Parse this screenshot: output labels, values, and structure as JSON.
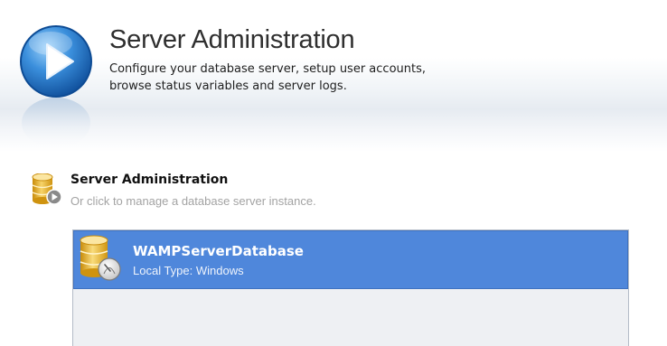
{
  "header": {
    "title": "Server Administration",
    "description": "Configure your database server, setup user accounts, browse status variables and server logs."
  },
  "section": {
    "title": "Server Administration",
    "subtitle": "Or click to manage a database server instance."
  },
  "instances": [
    {
      "name": "WAMPServerDatabase",
      "type_label": "Local Type: Windows",
      "selected": true
    }
  ],
  "icons": {
    "header_logo": "play-circle-icon",
    "section_icon": "database-play-icon",
    "instance_icon": "database-server-icon"
  },
  "colors": {
    "selection_blue": "#4f87db",
    "logo_blue": "#1f73c7",
    "database_gold": "#e9b01d",
    "subtitle_gray": "#a3a3a3"
  }
}
